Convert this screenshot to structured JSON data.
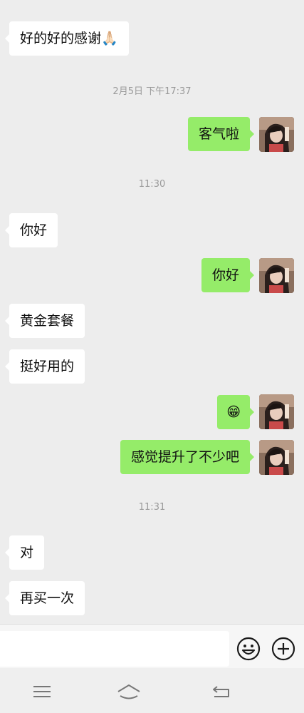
{
  "messages": [
    {
      "text": "好的好的感谢🙏🏻"
    },
    {
      "text": "客气啦"
    },
    {
      "text": "你好"
    },
    {
      "text": "你好"
    },
    {
      "text": "黄金套餐"
    },
    {
      "text": "挺好用的"
    },
    {
      "text": "😁"
    },
    {
      "text": "感觉提升了不少吧"
    },
    {
      "text": "对"
    },
    {
      "text": "再买一次"
    }
  ],
  "timestamps": [
    "2月5日 下午17:37",
    "11:30",
    "11:31"
  ],
  "input": {
    "value": ""
  },
  "icons": {
    "emoji": "smiley-icon",
    "more": "plus-circle-icon",
    "menu": "menu-icon",
    "home": "home-icon",
    "back": "back-icon"
  },
  "colors": {
    "outgoing_bubble": "#95ec69",
    "incoming_bubble": "#ffffff",
    "background": "#ededed"
  }
}
